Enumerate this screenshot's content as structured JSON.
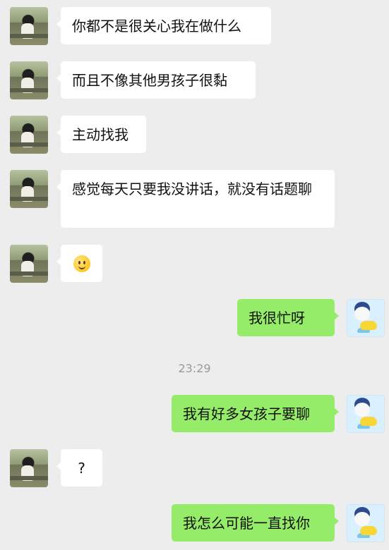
{
  "messages": [
    {
      "text": "你都不是很关心我在做什么"
    },
    {
      "text": "而且不像其他男孩子很黏"
    },
    {
      "text": "主动找我"
    },
    {
      "text": "感觉每天只要我没讲话，就没有话题聊"
    },
    {
      "emoji": "smiling-face"
    },
    {
      "text": "我很忙呀"
    },
    {
      "time": "23:29"
    },
    {
      "text": "我有好多女孩子要聊"
    },
    {
      "text": "?"
    },
    {
      "text": "我怎么可能一直找你"
    }
  ]
}
